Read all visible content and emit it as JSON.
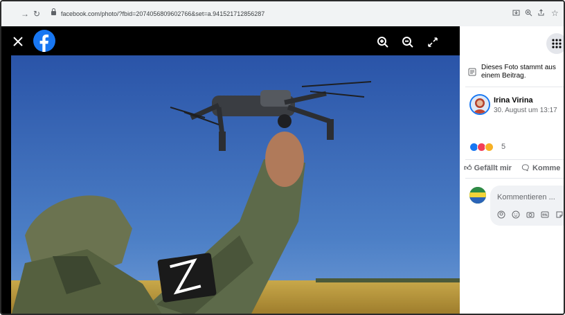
{
  "browser": {
    "url": "facebook.com/photo/?fbid=2074056809602766&set=a.941521712856287",
    "back_icon": "arrow-right-icon",
    "reload_icon": "reload-icon",
    "right_icons": [
      "install-icon",
      "zoom-icon",
      "share-icon",
      "star-icon"
    ]
  },
  "viewer": {
    "close_icon": "close-icon",
    "logo": "facebook-logo",
    "tools": [
      "zoom-in-icon",
      "zoom-out-icon",
      "fullscreen-icon"
    ]
  },
  "panel": {
    "apps_icon": "grid-menu-icon",
    "notice": "Dieses Foto stammt aus einem Beitrag.",
    "author": "Irina Virina",
    "date": "30. August um 13:17",
    "reaction_count": "5",
    "reaction_types": [
      "like",
      "love",
      "care"
    ],
    "like_label": "Gefällt mir",
    "comment_label": "Komme",
    "comment_placeholder": "Kommentieren ...",
    "comment_tools": [
      "avatar-sticker-icon",
      "emoji-icon",
      "camera-icon",
      "gif-icon",
      "sticker-icon"
    ]
  },
  "colors": {
    "brand": "#1877f2",
    "like": "#1877f2",
    "love": "#f33e58",
    "care": "#f7b125"
  }
}
